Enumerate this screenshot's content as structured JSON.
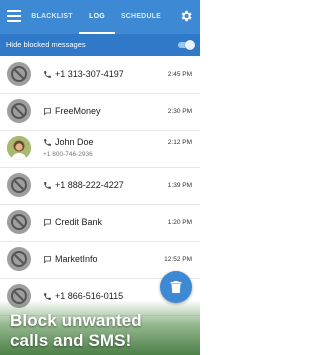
{
  "header": {
    "tabs": [
      {
        "label": "BLACKLIST",
        "active": false
      },
      {
        "label": "LOG",
        "active": true
      },
      {
        "label": "SCHEDULE",
        "active": false
      }
    ],
    "menu_icon": "hamburger-menu-icon",
    "settings_icon": "gear-icon"
  },
  "hide_blocked": {
    "label": "Hide blocked messages",
    "enabled": true
  },
  "log": [
    {
      "type": "call",
      "avatar": "blocked",
      "name": "+1 313-307-4197",
      "number": "",
      "time": "2:45 PM"
    },
    {
      "type": "message",
      "avatar": "blocked",
      "name": "FreeMoney",
      "number": "",
      "time": "2:30 PM"
    },
    {
      "type": "call",
      "avatar": "photo",
      "name": "John Doe",
      "number": "+1 800-746-2936",
      "time": "2:12 PM"
    },
    {
      "type": "call",
      "avatar": "blocked",
      "name": "+1 888-222-4227",
      "number": "",
      "time": "1:39 PM"
    },
    {
      "type": "message",
      "avatar": "blocked",
      "name": "Credit Bank",
      "number": "",
      "time": "1:20 PM"
    },
    {
      "type": "message",
      "avatar": "blocked",
      "name": "MarketInfo",
      "number": "",
      "time": "12:52 PM"
    },
    {
      "type": "call",
      "avatar": "blocked",
      "name": "+1 866-516-0115",
      "number": "",
      "time": ""
    }
  ],
  "fab_icon": "trash-icon",
  "promo": {
    "line1": "Block unwanted",
    "line2": "calls and SMS!"
  },
  "colors": {
    "toolbar": "#3d89d4",
    "subbar": "#3079c9",
    "accent": "#3d89d4"
  }
}
